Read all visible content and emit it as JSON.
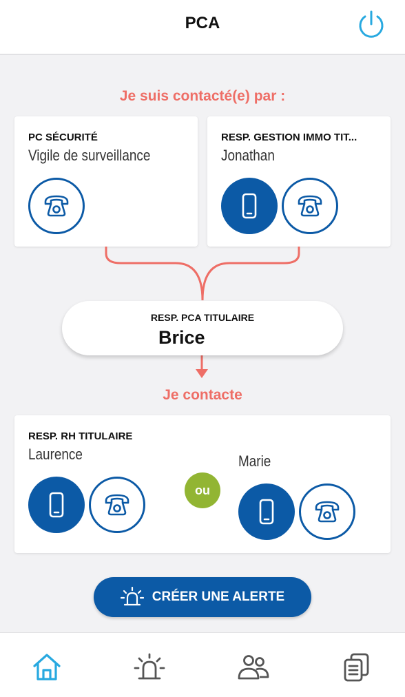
{
  "header": {
    "title": "PCA",
    "power_icon": "power-icon"
  },
  "contacted_by": {
    "label": "Je suis contacté(e) par :",
    "cards": [
      {
        "title": "PC SÉCURITÉ",
        "name": "Vigile de surveillance",
        "buttons": [
          "phone-icon"
        ]
      },
      {
        "title": "RESP. GESTION IMMO TIT...",
        "name": "Jonathan",
        "buttons": [
          "mobile-icon",
          "phone-icon"
        ]
      }
    ]
  },
  "self": {
    "role": "RESP. PCA TITULAIRE",
    "name": "Brice"
  },
  "contacts": {
    "label": "Je contacte",
    "card": {
      "title": "RESP. RH TITULAIRE",
      "primary_name": "Laurence",
      "separator": "ou",
      "alternate_name": "Marie"
    }
  },
  "alert_button": {
    "label": "CRÉER UNE ALERTE",
    "icon": "alarm-icon"
  },
  "nav": {
    "items": [
      "home-icon",
      "alarm-icon",
      "users-icon",
      "documents-icon"
    ],
    "active": "home-icon"
  },
  "colors": {
    "primary": "#0c5aa6",
    "accent": "#ee6e66",
    "or_badge": "#92b533",
    "active_nav": "#28a9e0",
    "nav_icon": "#555555"
  }
}
